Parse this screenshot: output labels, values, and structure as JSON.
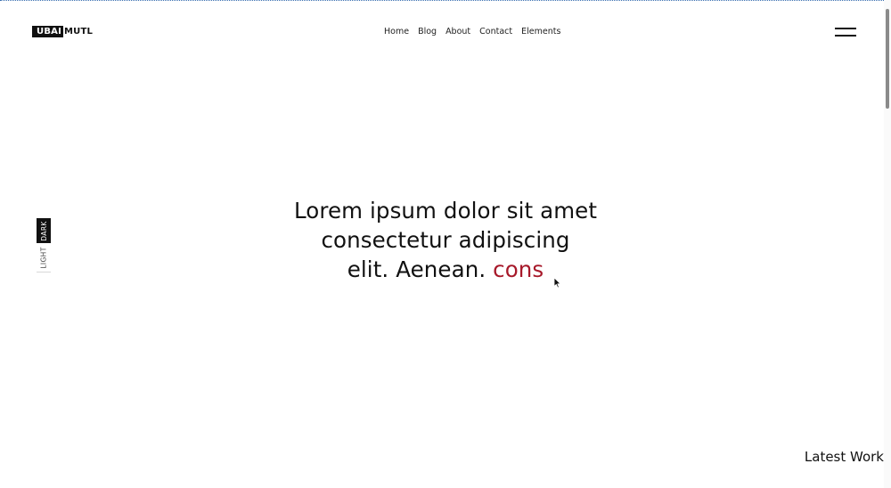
{
  "header": {
    "logo": {
      "box_text": "UBAI",
      "rest_text": "MUTL"
    },
    "nav": [
      {
        "label": "Home"
      },
      {
        "label": "Blog"
      },
      {
        "label": "About"
      },
      {
        "label": "Contact"
      },
      {
        "label": "Elements"
      }
    ],
    "menu_icon": "hamburger-icon"
  },
  "theme_switch": {
    "dark_label": "DARK",
    "light_label": "LIGHT"
  },
  "hero": {
    "line1": "Lorem ipsum dolor sit amet",
    "line2": "consectetur adipiscing",
    "line3": "elit. Aenean.",
    "typed_word": "cons"
  },
  "section_label": "Latest Work",
  "colors": {
    "accent": "#a7192a",
    "text": "#111111",
    "background": "#ffffff"
  }
}
